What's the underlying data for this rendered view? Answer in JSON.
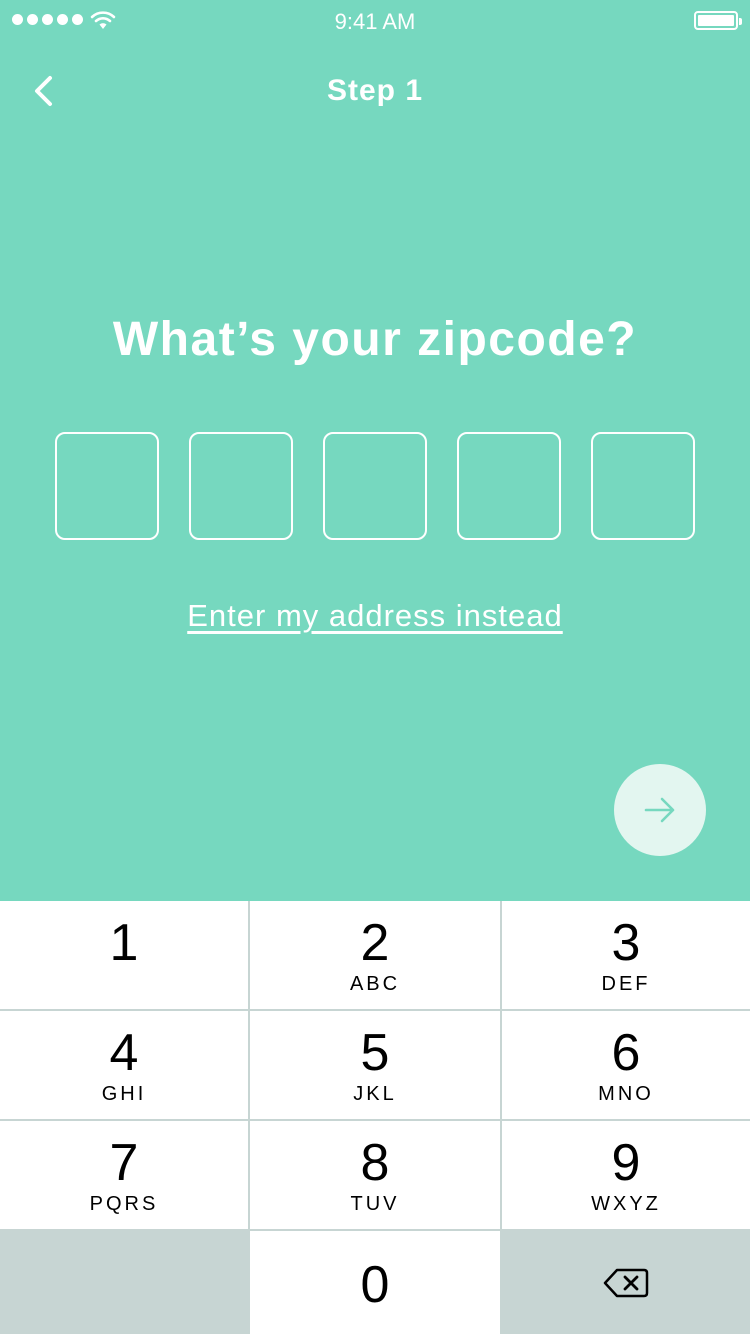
{
  "status_bar": {
    "time": "9:41 AM",
    "signal_icon": "signal-dots-icon",
    "wifi_icon": "wifi-icon",
    "battery_icon": "battery-icon",
    "battery_level": 1.0
  },
  "nav": {
    "title": "Step 1",
    "back_icon": "chevron-left-icon"
  },
  "main": {
    "question": "What’s your zipcode?",
    "code_boxes": [
      "",
      "",
      "",
      "",
      ""
    ],
    "alt_link": "Enter my address instead",
    "next_icon": "arrow-right-icon"
  },
  "keypad": {
    "keys": [
      {
        "digit": "1",
        "letters": ""
      },
      {
        "digit": "2",
        "letters": "ABC"
      },
      {
        "digit": "3",
        "letters": "DEF"
      },
      {
        "digit": "4",
        "letters": "GHI"
      },
      {
        "digit": "5",
        "letters": "JKL"
      },
      {
        "digit": "6",
        "letters": "MNO"
      },
      {
        "digit": "7",
        "letters": "PQRS"
      },
      {
        "digit": "8",
        "letters": "TUV"
      },
      {
        "digit": "9",
        "letters": "WXYZ"
      },
      {
        "digit": "0",
        "letters": ""
      }
    ],
    "delete_icon": "backspace-icon"
  },
  "colors": {
    "background": "#76d8bf",
    "next_button": "#e3f6f0",
    "keypad_gray": "#c7d5d3"
  }
}
